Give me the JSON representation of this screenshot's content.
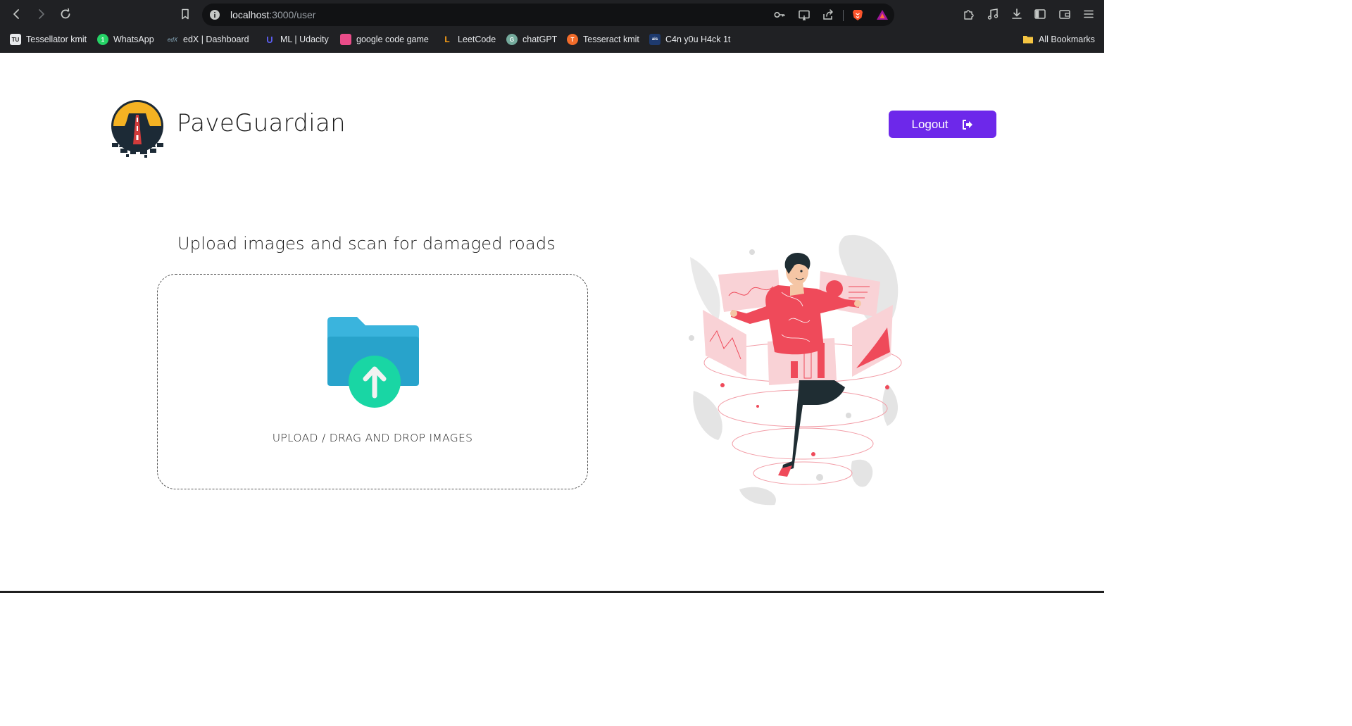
{
  "browser": {
    "url_host": "localhost",
    "url_path": ":3000/user",
    "bookmarks": [
      {
        "label": "Tessellator kmit",
        "icon": "tessellator-favicon",
        "color": "#e8eaed",
        "text": "TU"
      },
      {
        "label": "WhatsApp",
        "icon": "whatsapp-favicon",
        "color": "#25d366",
        "text": "1"
      },
      {
        "label": "edX  | Dashboard",
        "icon": "edx-favicon",
        "color": "#202124",
        "text": "edX"
      },
      {
        "label": "ML | Udacity",
        "icon": "udacity-favicon",
        "color": "#3b38d8",
        "text": "U"
      },
      {
        "label": "google code game",
        "icon": "google-code-game-favicon",
        "color": "#ea4c89",
        "text": ""
      },
      {
        "label": "LeetCode",
        "icon": "leetcode-favicon",
        "color": "#202124",
        "text": "L"
      },
      {
        "label": "chatGPT",
        "icon": "chatgpt-favicon",
        "color": "#74aa9c",
        "text": "G"
      },
      {
        "label": "Tesseract kmit",
        "icon": "tesseract-favicon",
        "color": "#f26c2a",
        "text": "T"
      },
      {
        "label": "C4n y0u H4ck 1t",
        "icon": "hackathon-favicon",
        "color": "#1e3a6e",
        "text": "ais"
      }
    ],
    "all_bookmarks_label": "All Bookmarks"
  },
  "header": {
    "brand": "PaveGuardian",
    "logout_label": "Logout"
  },
  "main": {
    "headline": "Upload images and scan for damaged roads",
    "dropzone_label": "UPLOAD / DRAG AND DROP IMAGES"
  },
  "colors": {
    "accent": "#6d28ea",
    "folder_back": "#3aaed8",
    "folder_front": "#2aa6cc",
    "upload_circle": "#1fd8a4",
    "illustration_red": "#ef4a5a"
  }
}
